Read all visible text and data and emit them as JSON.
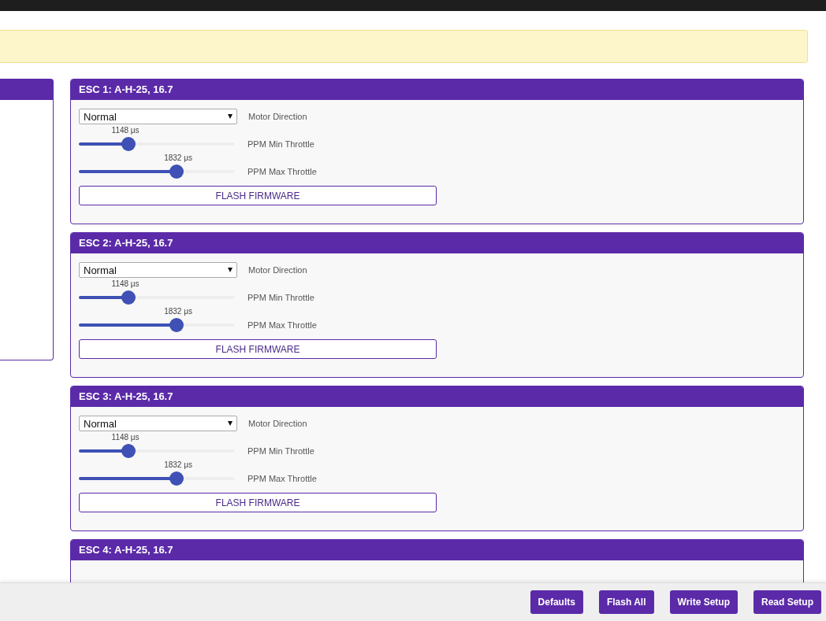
{
  "notice": {
    "shown": true
  },
  "escs": [
    {
      "title": "ESC 1: A-H-25, 16.7",
      "direction": "Normal",
      "direction_label": "Motor Direction",
      "sliders": [
        {
          "reading": "1148 μs",
          "level": 0.3,
          "label": "PPM Min Throttle"
        },
        {
          "reading": "1832 μs",
          "level": 0.64,
          "label": "PPM Max Throttle"
        }
      ],
      "button": "FLASH FIRMWARE"
    },
    {
      "title": "ESC 2: A-H-25, 16.7",
      "direction": "Normal",
      "direction_label": "Motor Direction",
      "sliders": [
        {
          "reading": "1148 μs",
          "level": 0.3,
          "label": "PPM Min Throttle"
        },
        {
          "reading": "1832 μs",
          "level": 0.64,
          "label": "PPM Max Throttle"
        }
      ],
      "button": "FLASH FIRMWARE"
    },
    {
      "title": "ESC 3: A-H-25, 16.7",
      "direction": "Normal",
      "direction_label": "Motor Direction",
      "sliders": [
        {
          "reading": "1148 μs",
          "level": 0.3,
          "label": "PPM Min Throttle"
        },
        {
          "reading": "1832 μs",
          "level": 0.64,
          "label": "PPM Max Throttle"
        }
      ],
      "button": "FLASH FIRMWARE"
    },
    {
      "title": "ESC 4: A-H-25, 16.7"
    }
  ],
  "footer_buttons": [
    "Defaults",
    "Flash All",
    "Write Setup",
    "Read Setup"
  ]
}
